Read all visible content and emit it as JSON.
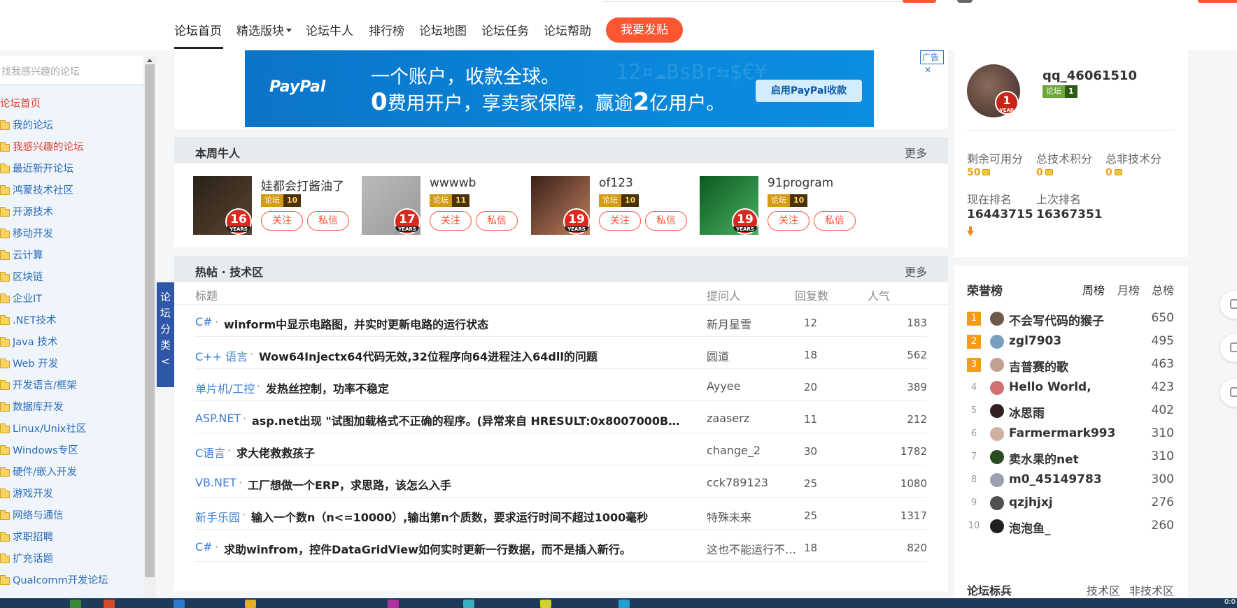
{
  "nav": {
    "items": [
      "论坛首页",
      "精选版块",
      "论坛牛人",
      "排行榜",
      "论坛地图",
      "论坛任务",
      "论坛帮助"
    ],
    "post_button": "我要发贴"
  },
  "sidebar": {
    "search_placeholder": "找我感兴趣的论坛",
    "items": [
      "论坛首页",
      "我的论坛",
      "我感兴趣的论坛",
      "最近新开论坛",
      "鸿蒙技术社区",
      "开源技术",
      "移动开发",
      "云计算",
      "区块链",
      "企业IT",
      ".NET技术",
      "Java 技术",
      "Web 开发",
      "开发语言/框架",
      "数据库开发",
      "Linux/Unix社区",
      "Windows专区",
      "硬件/嵌入开发",
      "游戏开发",
      "网络与通信",
      "求职招聘",
      "扩充话题",
      "Qualcomm开发论坛"
    ],
    "tab_label": "论坛分类<"
  },
  "ad": {
    "logo": "PayPal",
    "line1": "一个账户，收款全球。",
    "line2_a": "0",
    "line2_b": "费用开户，享卖家保障，赢逾",
    "line2_c": "2",
    "line2_d": "亿用户。",
    "cta": "启用PayPal收款",
    "tag": "广告"
  },
  "weekly": {
    "title": "本周牛人",
    "more": "更多",
    "users": [
      {
        "name": "娃都会打酱油了",
        "years": "16",
        "years_label": "YEARS",
        "badge_a": "论坛",
        "badge_b": "10",
        "follow": "关注",
        "message": "私信"
      },
      {
        "name": "wwwwb",
        "years": "17",
        "years_label": "YEARS",
        "badge_a": "论坛",
        "badge_b": "11",
        "follow": "关注",
        "message": "私信"
      },
      {
        "name": "of123",
        "years": "19",
        "years_label": "YEARS",
        "badge_a": "论坛",
        "badge_b": "10",
        "follow": "关注",
        "message": "私信"
      },
      {
        "name": "91program",
        "years": "19",
        "years_label": "YEARS",
        "badge_a": "论坛",
        "badge_b": "10",
        "follow": "关注",
        "message": "私信"
      }
    ]
  },
  "hot": {
    "title": "热帖 · 技术区",
    "more": "更多",
    "columns": [
      "标题",
      "提问人",
      "回复数",
      "人气"
    ],
    "rows": [
      {
        "cat": "C#",
        "title": "winform中显示电路图，并实时更新电路的运行状态",
        "who": "新月星雪",
        "replies": "12",
        "pop": "183"
      },
      {
        "cat": "C++ 语言",
        "title": "Wow64Injectx64代码无效,32位程序向64进程注入64dll的问题",
        "who": "圆道",
        "replies": "18",
        "pop": "562"
      },
      {
        "cat": "单片机/工控",
        "title": "发热丝控制，功率不稳定",
        "who": "Ayyee",
        "replies": "20",
        "pop": "389"
      },
      {
        "cat": "ASP.NET",
        "title": "asp.net出现 \"试图加载格式不正确的程序。(异常来自 HRESULT:0x8007000B…",
        "who": "zaaserz",
        "replies": "11",
        "pop": "212"
      },
      {
        "cat": "C语言",
        "title": "求大佬救救孩子",
        "who": "change_2",
        "replies": "30",
        "pop": "1782"
      },
      {
        "cat": "VB.NET",
        "title": "工厂想做一个ERP，求思路，该怎么入手",
        "who": "cck789123",
        "replies": "25",
        "pop": "1080"
      },
      {
        "cat": "新手乐园",
        "title": "输入一个数n（n<=10000）,输出第n个质数，要求运行时间不超过1000毫秒",
        "who": "特殊未来",
        "replies": "25",
        "pop": "1317"
      },
      {
        "cat": "C#",
        "title": "求助winfrom，控件DataGridView如何实时更新一行数据，而不是插入新行。",
        "who": "这也不能运行不…",
        "replies": "18",
        "pop": "820"
      }
    ]
  },
  "profile": {
    "name": "qq_46061510",
    "years": "1",
    "years_label": "YEAR",
    "badge_a": "论坛",
    "badge_b": "1",
    "stats": [
      {
        "label": "剩余可用分",
        "value": "50"
      },
      {
        "label": "总技术积分",
        "value": "0"
      },
      {
        "label": "总非技术分",
        "value": "0"
      }
    ],
    "rank_now_label": "现在排名",
    "rank_now": "16443715",
    "rank_prev_label": "上次排名",
    "rank_prev": "16367351"
  },
  "honor": {
    "title": "荣誉榜",
    "tabs": [
      "周榜",
      "月榜",
      "总榜"
    ],
    "rows": [
      {
        "rank": "1",
        "name": "不会写代码的猴子",
        "score": "650"
      },
      {
        "rank": "2",
        "name": "zgl7903",
        "score": "495"
      },
      {
        "rank": "3",
        "name": "吉普赛的歌",
        "score": "463"
      },
      {
        "rank": "4",
        "name": "Hello World,",
        "score": "423"
      },
      {
        "rank": "5",
        "name": "冰思雨",
        "score": "402"
      },
      {
        "rank": "6",
        "name": "Farmermark993",
        "score": "310"
      },
      {
        "rank": "7",
        "name": "卖水果的net",
        "score": "310"
      },
      {
        "rank": "8",
        "name": "m0_45149783",
        "score": "300"
      },
      {
        "rank": "9",
        "name": "qzjhjxj",
        "score": "276"
      },
      {
        "rank": "10",
        "name": "泡泡鱼_",
        "score": "260"
      }
    ],
    "bottom_title": "论坛标兵",
    "bottom_tabs": [
      "技术区",
      "非技术区"
    ]
  },
  "colors": {
    "accent": "#fc5531",
    "link": "#3f7fd5",
    "rank_top": "#f59a1b"
  }
}
